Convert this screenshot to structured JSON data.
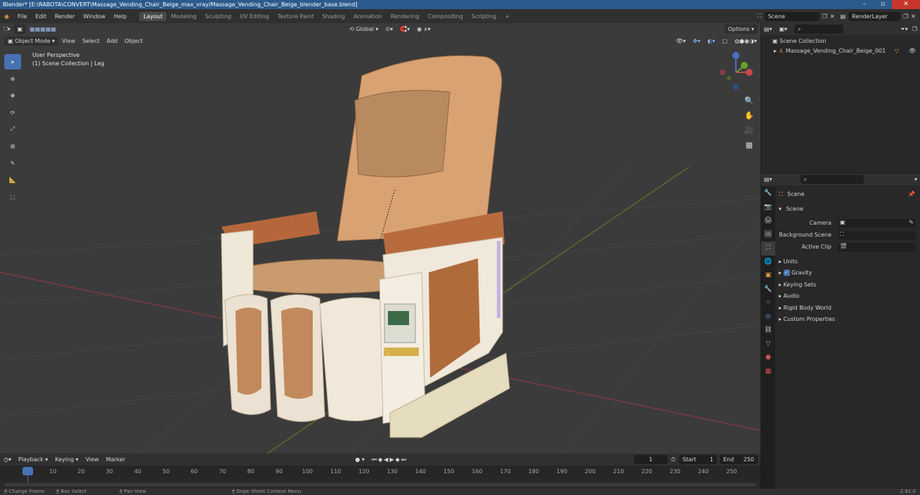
{
  "window": {
    "title": "Blender* [E:\\RABOTA\\CONVERT\\Massage_Vending_Chair_Beige_max_vray/Massage_Vending_Chair_Beige_blender_base.blend]"
  },
  "menu": [
    "File",
    "Edit",
    "Render",
    "Window",
    "Help"
  ],
  "workspaces": [
    "Layout",
    "Modeling",
    "Sculpting",
    "UV Editing",
    "Texture Paint",
    "Shading",
    "Animation",
    "Rendering",
    "Compositing",
    "Scripting"
  ],
  "active_workspace": "Layout",
  "scene_name": "Scene",
  "render_layer": "RenderLayer",
  "viewport": {
    "mode": "Object Mode",
    "menus": [
      "View",
      "Select",
      "Add",
      "Object"
    ],
    "transform_orientation": "Global",
    "options_label": "Options",
    "overlay_line1": "User Perspective",
    "overlay_line2": "(1) Scene Collection | Leg"
  },
  "outliner": {
    "root": "Scene Collection",
    "item": "Massage_Vending_Chair_Beige_001"
  },
  "properties": {
    "header": "Scene",
    "panel": "Scene",
    "camera_label": "Camera",
    "background_label": "Background Scene",
    "active_clip_label": "Active Clip",
    "sections": [
      "Units",
      "Gravity",
      "Keying Sets",
      "Audio",
      "Rigid Body World",
      "Custom Properties"
    ],
    "gravity_checked": true
  },
  "timeline": {
    "menus": [
      "Playback",
      "Keying",
      "View",
      "Marker"
    ],
    "current_frame": "1",
    "start_label": "Start",
    "start": "1",
    "end_label": "End",
    "end": "250",
    "ticks": [
      "1",
      "10",
      "20",
      "30",
      "40",
      "50",
      "60",
      "70",
      "80",
      "90",
      "100",
      "110",
      "120",
      "130",
      "140",
      "150",
      "160",
      "170",
      "180",
      "190",
      "200",
      "210",
      "220",
      "230",
      "240",
      "250"
    ]
  },
  "statusbar": {
    "items": [
      "Change Frame",
      "Box Select",
      "Pan View",
      "Dope Sheet Context Menu"
    ],
    "version": "2.92.0"
  },
  "colors": {
    "accent": "#4772b3",
    "header": "#303030",
    "panel": "#282828",
    "viewport": "#3b3b3b"
  }
}
